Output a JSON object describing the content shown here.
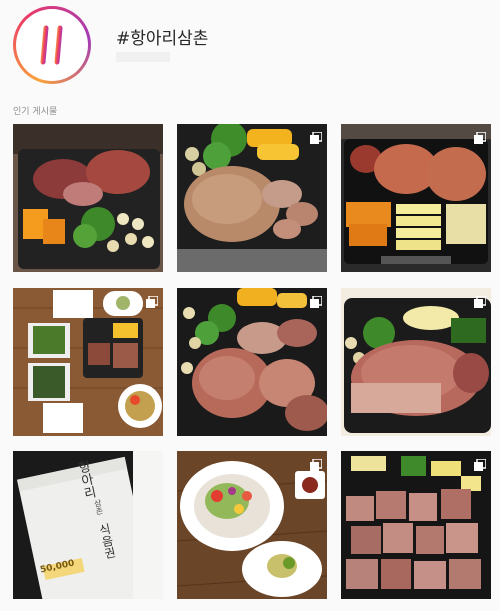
{
  "header": {
    "hashtag": "#항아리삼촌"
  },
  "section": {
    "label": "인기 게시물"
  },
  "posts": [
    {
      "kind": "photo",
      "multi": false,
      "theme": "pork-grill-1"
    },
    {
      "kind": "photo",
      "multi": true,
      "theme": "pork-grill-2"
    },
    {
      "kind": "photo",
      "multi": true,
      "theme": "pork-grill-3"
    },
    {
      "kind": "photo",
      "multi": true,
      "theme": "table-set"
    },
    {
      "kind": "photo",
      "multi": true,
      "theme": "pork-grill-4"
    },
    {
      "kind": "photo",
      "multi": true,
      "theme": "pork-grill-5"
    },
    {
      "kind": "photo",
      "multi": false,
      "theme": "voucher"
    },
    {
      "kind": "photo",
      "multi": true,
      "theme": "salad"
    },
    {
      "kind": "photo",
      "multi": true,
      "theme": "pork-cubes"
    }
  ],
  "voucher": {
    "brand": "항아리",
    "sub": "삼촌",
    "title": "식음권",
    "amount": "50,000"
  },
  "colors": {
    "background": "#fafafa",
    "accent_orange": "#f9a23a",
    "accent_pink": "#ea3a68",
    "accent_purple": "#a33bb5"
  }
}
